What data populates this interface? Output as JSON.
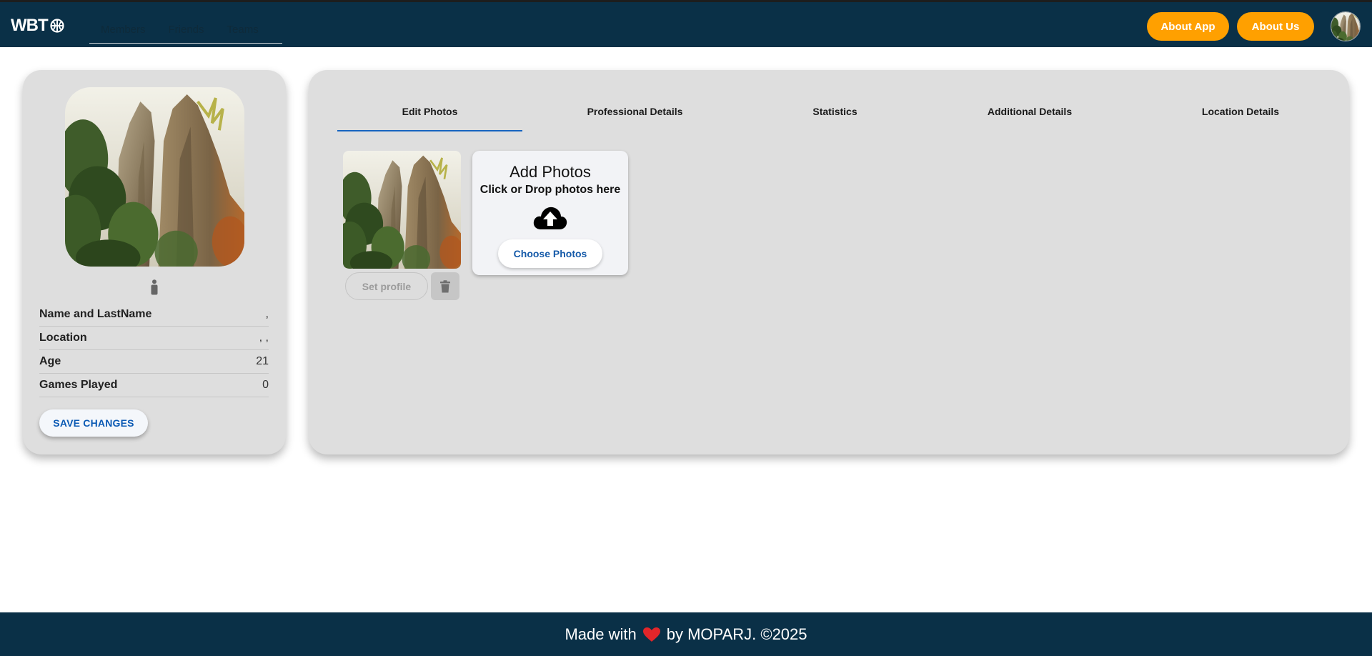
{
  "header": {
    "logo_text": "WBT",
    "nav": [
      "Members",
      "Friends",
      "Teams"
    ],
    "about_app": "About App",
    "about_us": "About Us"
  },
  "profile": {
    "rows": [
      {
        "label": "Name and LastName",
        "value": ","
      },
      {
        "label": "Location",
        "value": ", ,"
      },
      {
        "label": "Age",
        "value": "21"
      },
      {
        "label": "Games Played",
        "value": "0"
      }
    ],
    "save_label": "SAVE CHANGES"
  },
  "tabs": {
    "items": [
      "Edit Photos",
      "Professional Details",
      "Statistics",
      "Additional Details",
      "Location Details"
    ],
    "active": "Edit Photos"
  },
  "photos": {
    "set_profile": "Set profile",
    "add_title": "Add Photos",
    "add_subtitle": "Click or Drop photos here",
    "choose_label": "Choose Photos"
  },
  "footer": {
    "prefix": "Made with",
    "suffix": "by MOPARJ. ©2025"
  },
  "colors": {
    "navbar": "#0a3047",
    "accent_orange": "#ffa000",
    "tab_underline": "#1764c0",
    "panel_bg": "#dedede"
  },
  "icons": {
    "logo": "basketball-icon",
    "person": "person-icon",
    "delete": "trash-icon",
    "upload": "cloud-upload-icon",
    "heart": "heart-icon"
  }
}
